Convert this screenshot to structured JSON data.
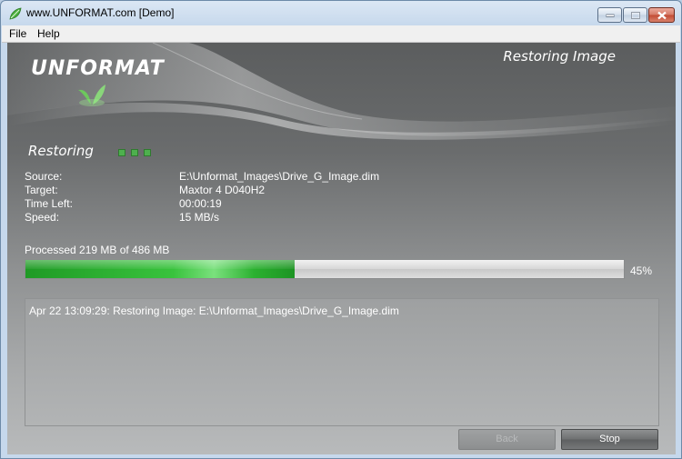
{
  "window": {
    "title": "www.UNFORMAT.com [Demo]",
    "icon": "leaf-icon",
    "controls": [
      "minimize-icon",
      "maximize-icon",
      "close-icon"
    ]
  },
  "menu": {
    "file": "File",
    "help": "Help"
  },
  "banner": {
    "logo": "UNFORMAT",
    "page_title": "Restoring Image"
  },
  "status": {
    "title": "Restoring"
  },
  "info": {
    "source_label": "Source:",
    "source_value": "E:\\Unformat_Images\\Drive_G_Image.dim",
    "target_label": "Target:",
    "target_value": "Maxtor 4 D040H2",
    "time_left_label": "Time Left:",
    "time_left_value": "00:00:19",
    "speed_label": "Speed:",
    "speed_value": "15 MB/s"
  },
  "progress": {
    "text": "Processed 219 MB of 486 MB",
    "percent_label": "45%",
    "fraction": 0.45
  },
  "log": {
    "line": "Apr 22 13:09:29: Restoring Image: E:\\Unformat_Images\\Drive_G_Image.dim"
  },
  "buttons": {
    "back": "Back",
    "stop": "Stop"
  },
  "colors": {
    "progress": "#39c33d",
    "background": "#6a6c6d",
    "accent_green": "#4eb04e"
  }
}
